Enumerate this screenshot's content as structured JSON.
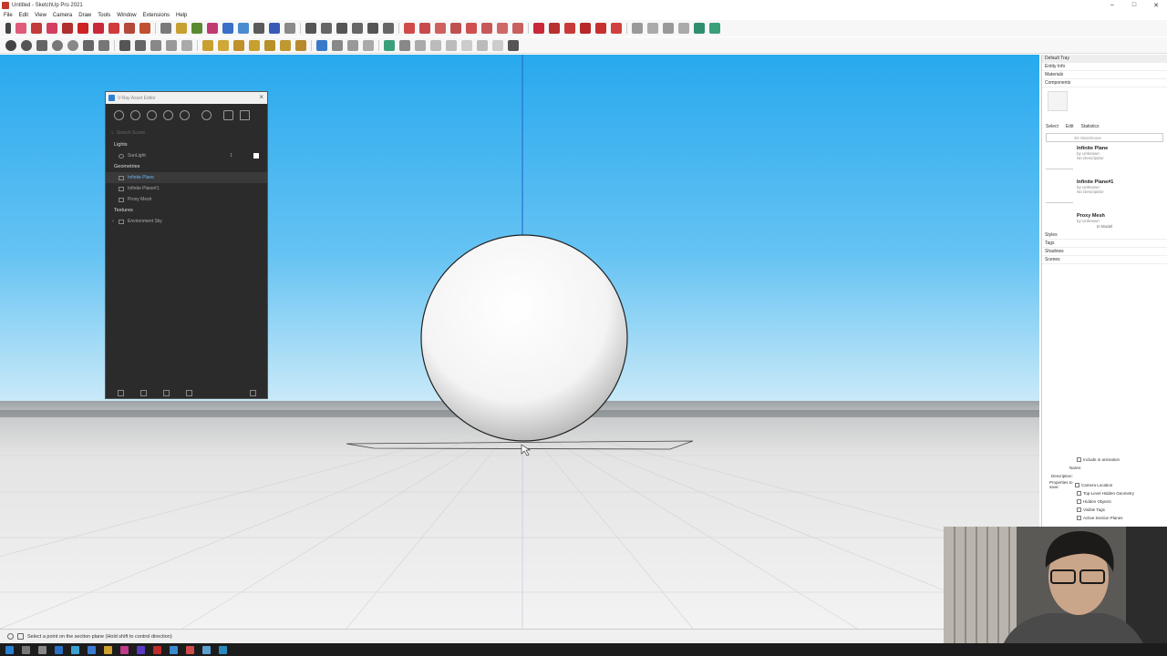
{
  "window": {
    "title": "Untitled - SketchUp Pro 2021",
    "controls": [
      "–",
      "□",
      "✕"
    ]
  },
  "menu": [
    "File",
    "Edit",
    "View",
    "Camera",
    "Draw",
    "Tools",
    "Window",
    "Extensions",
    "Help"
  ],
  "vray_editor": {
    "title": "V-Ray Asset Editor",
    "search_placeholder": "Search Scene",
    "sections": {
      "lights": "Lights",
      "geometries": "Geometries",
      "textures": "Textures"
    },
    "lights": [
      {
        "name": "SunLight",
        "count": "1"
      }
    ],
    "geometries": [
      "Infinite Plane",
      "Infinite Plane#1",
      "Proxy Mesh"
    ],
    "textures": [
      "Environment Sky"
    ]
  },
  "tray": {
    "title": "Default Tray",
    "panels_top": [
      "Entity Info",
      "Materials",
      "Components"
    ],
    "tabs": [
      "Select",
      "Edit",
      "Statistics"
    ],
    "search_value": "3D Warehouse",
    "components": [
      {
        "name": "Infinite Plane",
        "author": "by Unknown",
        "desc": "No Description"
      },
      {
        "name": "Infinite Plane#1",
        "author": "by Unknown",
        "desc": "No Description"
      },
      {
        "name": "Proxy Mesh",
        "author": "by Unknown",
        "desc": ""
      }
    ],
    "in_model": "In Model",
    "panels_bottom": [
      "Styles",
      "Tags",
      "Shadows",
      "Scenes"
    ],
    "scenes_form": {
      "include_animation": "Include in animation",
      "name_label": "Name:",
      "description_label": "Description:",
      "properties_label": "Properties to save:",
      "properties": [
        "Camera Location",
        "Top-Level Hidden Geometry",
        "Hidden Objects",
        "Visible Tags",
        "Active Section Planes"
      ]
    }
  },
  "status": {
    "hint": "Select a point on the section plane (Hold shift to control direction)"
  },
  "colors": {
    "sky_top": "#28a9ee",
    "vray_panel": "#2b2b2b",
    "vray_selected": "#6cb4ee"
  }
}
